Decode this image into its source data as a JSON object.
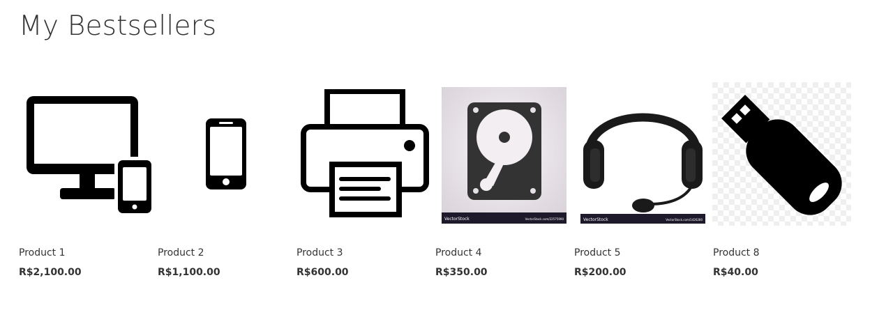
{
  "title": "My Bestsellers",
  "products": [
    {
      "name": "Product 1",
      "price": "R$2,100.00",
      "icon": "monitor-phone-icon"
    },
    {
      "name": "Product 2",
      "price": "R$1,100.00",
      "icon": "smartphone-icon"
    },
    {
      "name": "Product 3",
      "price": "R$600.00",
      "icon": "printer-icon"
    },
    {
      "name": "Product 4",
      "price": "R$350.00",
      "icon": "hard-drive-icon"
    },
    {
      "name": "Product 5",
      "price": "R$200.00",
      "icon": "headset-icon"
    },
    {
      "name": "Product 8",
      "price": "R$40.00",
      "icon": "usb-drive-icon"
    }
  ],
  "watermarks": {
    "brand": "VectorStock",
    "url_4": "VectorStock.com/22575990",
    "url_5": "VectorStock.com/1426280"
  }
}
